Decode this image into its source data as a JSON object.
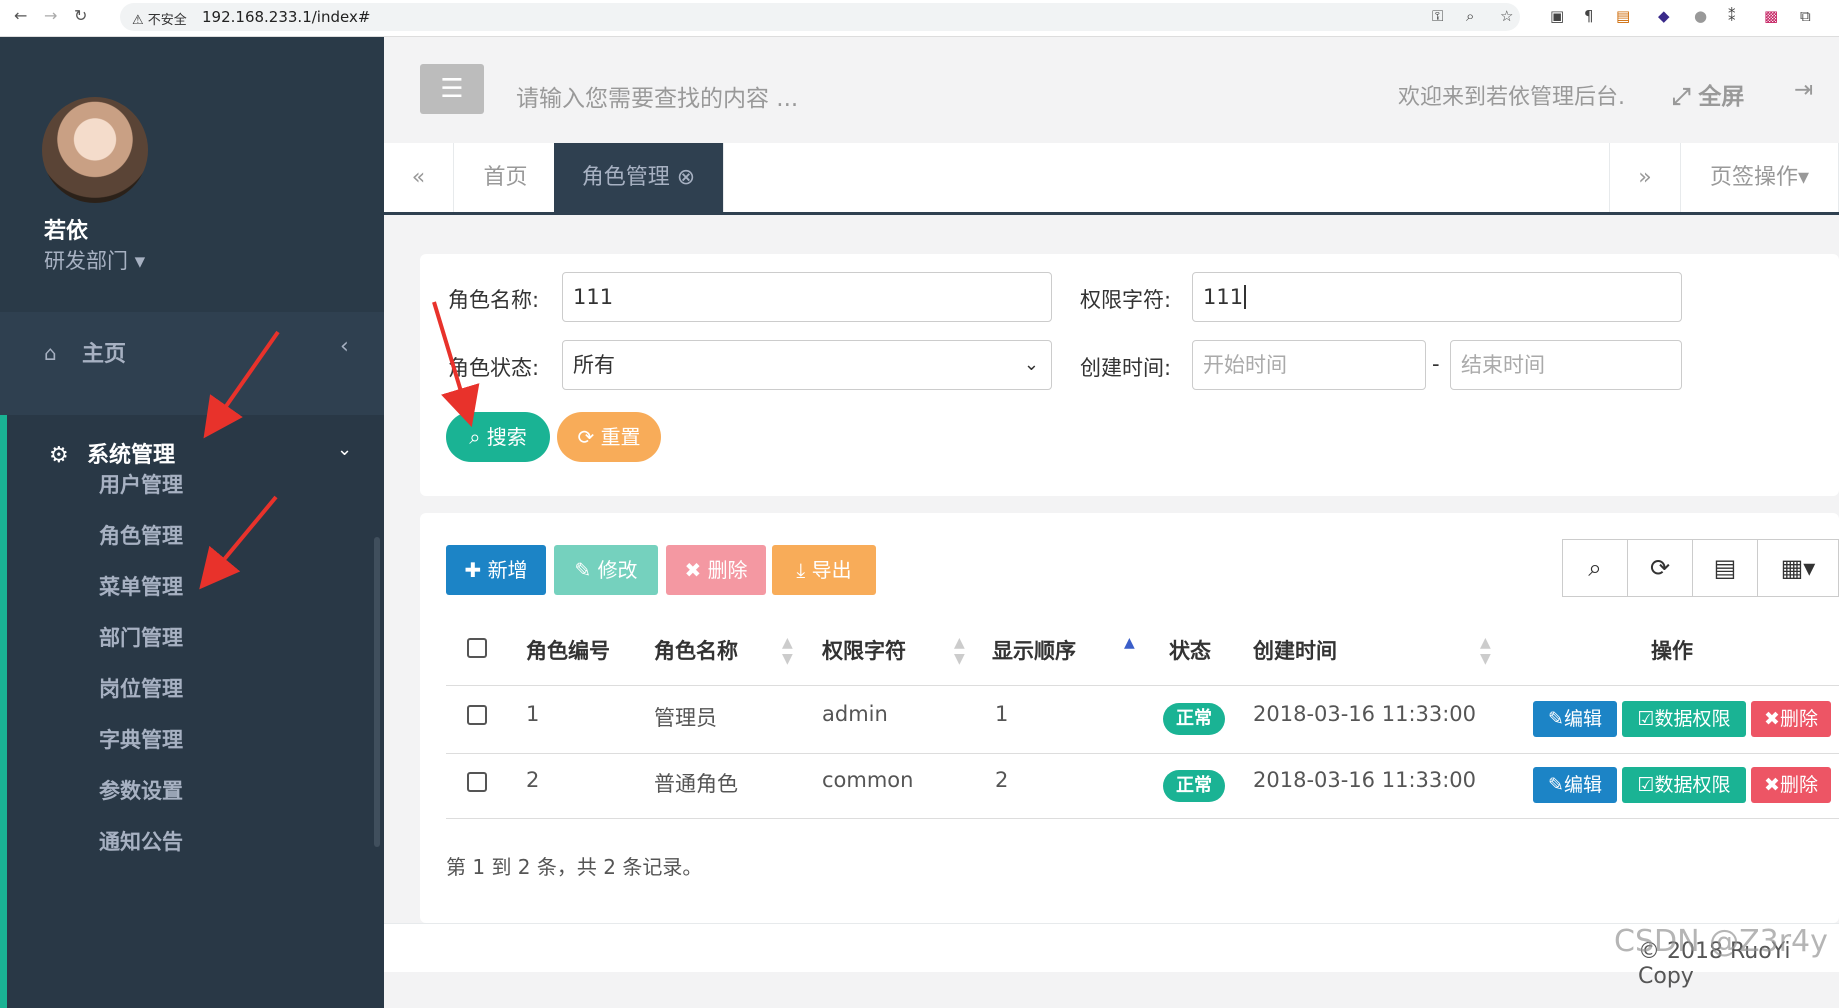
{
  "browser": {
    "security_label": "⚠ 不安全",
    "url": "192.168.233.1/index#"
  },
  "sidebar": {
    "user_name": "若依",
    "dept": "研发部门 ▾",
    "home_label": "主页",
    "system_label": "系统管理",
    "sub_items": [
      {
        "label": "用户管理"
      },
      {
        "label": "角色管理"
      },
      {
        "label": "菜单管理"
      },
      {
        "label": "部门管理"
      },
      {
        "label": "岗位管理"
      },
      {
        "label": "字典管理"
      },
      {
        "label": "参数设置"
      },
      {
        "label": "通知公告"
      }
    ]
  },
  "header": {
    "search_placeholder": "请输入您需要查找的内容 ...",
    "welcome": "欢迎来到若依管理后台.",
    "fullscreen": "全屏"
  },
  "tabs": {
    "home": "首页",
    "active": "角色管理",
    "page_ops": "页签操作▾"
  },
  "search_form": {
    "role_name_label": "角色名称:",
    "role_name_value": "111",
    "role_key_label": "权限字符:",
    "role_key_value": "111",
    "status_label": "角色状态:",
    "status_value": "所有",
    "created_label": "创建时间:",
    "start_placeholder": "开始时间",
    "end_placeholder": "结束时间",
    "dash": "-",
    "search_btn": "搜索",
    "reset_btn": "重置"
  },
  "toolbar": {
    "add": "新增",
    "edit": "修改",
    "delete": "删除",
    "export": "导出"
  },
  "table": {
    "columns": [
      "角色编号",
      "角色名称",
      "权限字符",
      "显示顺序",
      "状态",
      "创建时间",
      "操作"
    ],
    "rows": [
      {
        "id": "1",
        "name": "管理员",
        "key": "admin",
        "order": "1",
        "status": "正常",
        "created": "2018-03-16 11:33:00"
      },
      {
        "id": "2",
        "name": "普通角色",
        "key": "common",
        "order": "2",
        "status": "正常",
        "created": "2018-03-16 11:33:00"
      }
    ],
    "action_edit": "编辑",
    "action_perm": "数据权限",
    "action_delete": "删除",
    "pagination": "第 1 到 2 条，共 2 条记录。"
  },
  "footer": {
    "copyright": "© 2018 RuoYi Copy",
    "watermark": "CSDN @Z3r4y"
  },
  "colors": {
    "sidebar": "#2f4050",
    "primary": "#1ab394",
    "blue": "#1c84c6",
    "orange": "#f8ac59",
    "red": "#ed5565",
    "annotation_arrow": "#e8322b"
  }
}
